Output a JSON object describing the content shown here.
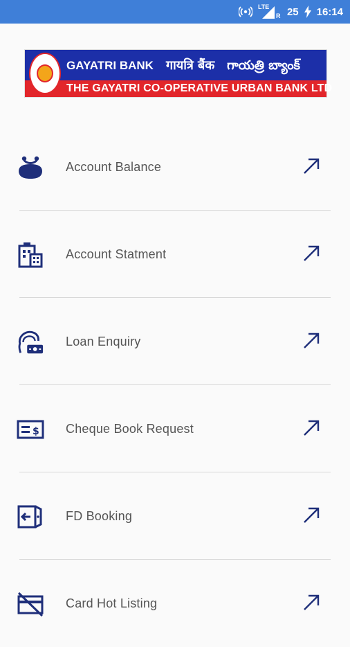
{
  "status_bar": {
    "network": "LTE",
    "roaming": "R",
    "battery": "25",
    "time": "16:14"
  },
  "logo": {
    "line1_en": "GAYATRI BANK",
    "line1_hi": "गायत्रि बैंक",
    "line1_te": "గాయత్రి బ్యాంక్",
    "line2": "THE GAYATRI CO-OPERATIVE URBAN BANK LTD"
  },
  "menu": [
    {
      "label": "Account Balance",
      "icon": "coin-purse-icon"
    },
    {
      "label": "Account Statment",
      "icon": "statement-building-icon"
    },
    {
      "label": "Loan Enquiry",
      "icon": "person-cash-icon"
    },
    {
      "label": "Cheque Book Request",
      "icon": "cheque-icon"
    },
    {
      "label": "FD Booking",
      "icon": "fd-booking-icon"
    },
    {
      "label": "Card Hot Listing",
      "icon": "card-blocked-icon"
    }
  ],
  "colors": {
    "status_bar": "#3f7fd8",
    "icon": "#1f2f7a",
    "logo_blue": "#1c2fa8",
    "logo_red": "#e2262b",
    "label": "#555555",
    "background": "#fafafa"
  }
}
